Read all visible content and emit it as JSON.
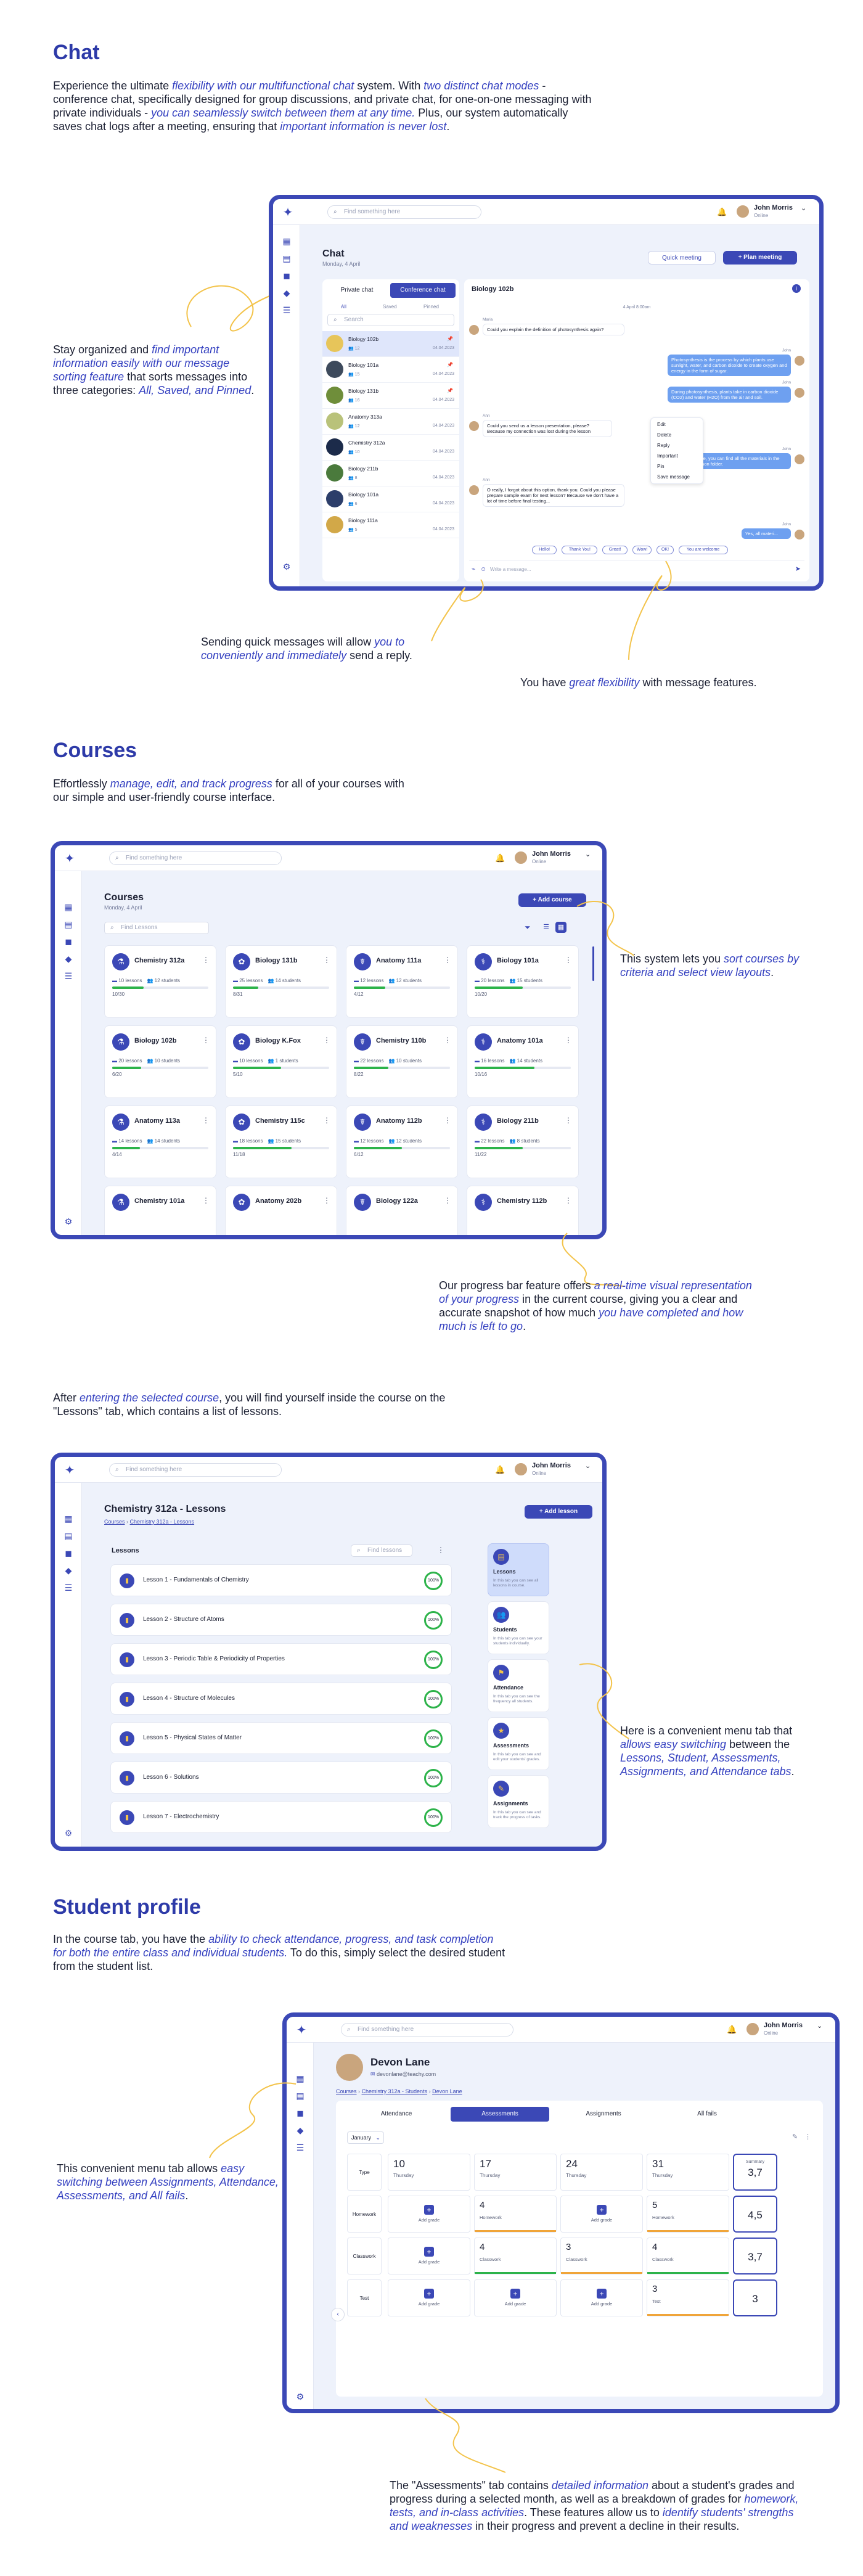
{
  "colors": {
    "accent": "#3b48b6",
    "emphasis": "#3440c0",
    "progress": "#2db34a",
    "warning": "#f0a53a"
  },
  "chat_section": {
    "title": "Chat",
    "intro": {
      "p1": "Experience the ultimate ",
      "e1": "flexibility with our multifunctional chat",
      "p2": " system. With ",
      "e2": "two distinct chat modes",
      "p3": " - conference chat, specifically designed for group discussions, and private chat, for one-on-one messaging with private individuals - ",
      "e3": "you can seamlessly switch between them at any time.",
      "p4": " Plus, our system automatically saves chat logs after a meeting, ensuring that ",
      "e4": "important information is never lost",
      "p5": "."
    },
    "note_left": {
      "p1": "Stay organized and ",
      "e1": "find important information easily with our message sorting feature",
      "p2": " that sorts messages into three categories: ",
      "e2": "All, Saved, and Pinned",
      "p3": "."
    },
    "note_bottom_left": {
      "p1": "Sending quick messages will allow ",
      "e1": "you to conveniently and immediately",
      "p2": " send a reply."
    },
    "note_bottom_right": {
      "p1": "You have ",
      "e1": "great flexibility",
      "p2": " with message features."
    },
    "app": {
      "search_placeholder": "Find something here",
      "user_name": "John Morris",
      "user_status": "Online",
      "page_title": "Chat",
      "page_date": "Monday, 4 April",
      "quick_meeting": "Quick meeting",
      "plan_meeting": "+ Plan meeting",
      "tabs": [
        "Private chat",
        "Conference chat"
      ],
      "filters": [
        "All",
        "Saved",
        "Pinned"
      ],
      "list_search": "Search",
      "chats": [
        {
          "name": "Biology 102b",
          "count": "12",
          "date": "04.04.2023",
          "pinned": true
        },
        {
          "name": "Biology 101a",
          "count": "15",
          "date": "04.04.2023",
          "pinned": true
        },
        {
          "name": "Biology 131b",
          "count": "16",
          "date": "04.04.2023",
          "pinned": true
        },
        {
          "name": "Anatomy 313a",
          "count": "12",
          "date": "04.04.2023",
          "pinned": false
        },
        {
          "name": "Chemistry 312a",
          "count": "10",
          "date": "04.04.2023",
          "pinned": false
        },
        {
          "name": "Biology 211b",
          "count": "8",
          "date": "04.04.2023",
          "pinned": false
        },
        {
          "name": "Biology 101a",
          "count": "6",
          "date": "04.04.2023",
          "pinned": false
        },
        {
          "name": "Biology 111a",
          "count": "5",
          "date": "04.04.2023",
          "pinned": false
        }
      ],
      "conversation_title": "Biology 102b",
      "conversation_date": "4 April 8:00am",
      "messages": [
        {
          "author": "Maria",
          "text": "Could you explain the definition of photosynthesis again?",
          "type": "in"
        },
        {
          "author": "John",
          "text": "Photosynthesis is the process by which plants use sunlight, water, and carbon dioxide to create oxygen and energy in the form of sugar.",
          "type": "out"
        },
        {
          "author": "John",
          "text": "During photosynthesis, plants take in carbon dioxide (CO2) and water (H2O) from the air and soil.",
          "type": "out"
        },
        {
          "author": "Ann",
          "text": "Could you send us a lesson presentation, please? Because my connection was lost during the lesson",
          "type": "in"
        },
        {
          "author": "John",
          "text": "Sure, you can find all the materials in the lesson folder.",
          "type": "out"
        },
        {
          "author": "Ann",
          "text": "O really, I forgot about this option, thank you. Could you please prepare sample exam for next lesson? Because we don't have a lot of time before final testing...",
          "type": "in"
        },
        {
          "author": "John",
          "text": "Yes, all materi...",
          "type": "out"
        }
      ],
      "context_menu": [
        "Edit",
        "Delete",
        "Reply",
        "Important",
        "Pin",
        "Save message"
      ],
      "quick_replies": [
        "Hello!",
        "Thank You!",
        "Great!",
        "Wow!",
        "OK!",
        "You are welcome"
      ],
      "message_placeholder": "Write a message..."
    }
  },
  "courses_section": {
    "title": "Courses",
    "intro": {
      "p1": "Effortlessly ",
      "e1": "manage, edit, and track progress",
      "p2": " for all of your courses with our simple and user-friendly course interface."
    },
    "note_right": {
      "p1": "This system lets you ",
      "e1": "sort courses by criteria and select view layouts",
      "p2": "."
    },
    "note_bottom": {
      "p1": "Our progress bar feature offers ",
      "e1": "a real-time visual representation of your progress",
      "p2": " in the current course, giving you a clear and accurate snapshot of how much ",
      "e2": "you have completed and how much is left to go",
      "p3": "."
    },
    "app": {
      "search_placeholder": "Find something here",
      "user_name": "John Morris",
      "user_status": "Online",
      "page_title": "Courses",
      "page_date": "Monday, 4 April",
      "add_course": "+ Add course",
      "lessons_search": "Find Lessons",
      "cards": [
        {
          "title": "Chemistry 312a",
          "lessons": "10 lessons",
          "students": "12 students",
          "progress": "10/30",
          "pct": 0.33
        },
        {
          "title": "Biology 131b",
          "lessons": "25 lessons",
          "students": "14 students",
          "progress": "8/31",
          "pct": 0.26
        },
        {
          "title": "Anatomy 111a",
          "lessons": "12 lessons",
          "students": "12 students",
          "progress": "4/12",
          "pct": 0.33
        },
        {
          "title": "Biology 101a",
          "lessons": "20 lessons",
          "students": "15 students",
          "progress": "10/20",
          "pct": 0.5
        },
        {
          "title": "Biology 102b",
          "lessons": "20 lessons",
          "students": "10 students",
          "progress": "6/20",
          "pct": 0.3
        },
        {
          "title": "Biology K.Fox",
          "lessons": "10 lessons",
          "students": "1 students",
          "progress": "5/10",
          "pct": 0.5
        },
        {
          "title": "Chemistry 110b",
          "lessons": "22 lessons",
          "students": "10 students",
          "progress": "8/22",
          "pct": 0.36
        },
        {
          "title": "Anatomy 101a",
          "lessons": "16 lessons",
          "students": "14 students",
          "progress": "10/16",
          "pct": 0.62
        },
        {
          "title": "Anatomy 113a",
          "lessons": "14 lessons",
          "students": "14 students",
          "progress": "4/14",
          "pct": 0.29
        },
        {
          "title": "Chemistry 115c",
          "lessons": "18 lessons",
          "students": "15 students",
          "progress": "11/18",
          "pct": 0.61
        },
        {
          "title": "Anatomy 112b",
          "lessons": "12 lessons",
          "students": "12 students",
          "progress": "6/12",
          "pct": 0.5
        },
        {
          "title": "Biology 211b",
          "lessons": "22 lessons",
          "students": "8 students",
          "progress": "11/22",
          "pct": 0.5
        },
        {
          "title": "Chemistry 101a",
          "lessons": "",
          "students": "",
          "progress": "",
          "pct": 0
        },
        {
          "title": "Anatomy 202b",
          "lessons": "",
          "students": "",
          "progress": "",
          "pct": 0
        },
        {
          "title": "Biology 122a",
          "lessons": "",
          "students": "",
          "progress": "",
          "pct": 0
        },
        {
          "title": "Chemistry 112b",
          "lessons": "",
          "students": "",
          "progress": "",
          "pct": 0
        }
      ]
    }
  },
  "lessons_section": {
    "intro": {
      "p1": "After ",
      "e1": "entering the selected course",
      "p2": ", you will find yourself inside the course on the \"Lessons\" tab, which contains a list of lessons."
    },
    "note_right": {
      "p1": "Here is a convenient menu tab that ",
      "e1": "allows easy switching",
      "p2": " between the ",
      "e2": "Lessons, Student, Assessments, Assignments, and Attendance tabs",
      "p3": "."
    },
    "app": {
      "search_placeholder": "Find something here",
      "user_name": "John Morris",
      "user_status": "Online",
      "page_title": "Chemistry 312a - Lessons",
      "breadcrumb": [
        "Courses",
        "Chemistry 312a - Lessons"
      ],
      "add_lesson": "+ Add lesson",
      "list_title": "Lessons",
      "list_search": "Find lessons",
      "lessons": [
        {
          "title": "Lesson 1 - Fundamentals of Chemistry",
          "pct": "100%"
        },
        {
          "title": "Lesson 2 - Structure of Atoms",
          "pct": "100%"
        },
        {
          "title": "Lesson 3 - Periodic Table & Periodicity of Properties",
          "pct": "100%"
        },
        {
          "title": "Lesson 4 - Structure of Molecules",
          "pct": "100%"
        },
        {
          "title": "Lesson 5 - Physical States of Matter",
          "pct": "100%"
        },
        {
          "title": "Lesson 6 - Solutions",
          "pct": "100%"
        },
        {
          "title": "Lesson 7 - Electrochemistry",
          "pct": "100%"
        }
      ],
      "menu": [
        {
          "title": "Lessons",
          "desc": "In this tab you can see all lessons in course."
        },
        {
          "title": "Students",
          "desc": "In this tab you can see your students individually."
        },
        {
          "title": "Attendance",
          "desc": "In this tab you can see the frequency all students."
        },
        {
          "title": "Assessments",
          "desc": "In this tab you can see and edit your students' grades."
        },
        {
          "title": "Assignments",
          "desc": "In this tab you can see and track the progress of tasks."
        }
      ]
    }
  },
  "profile_section": {
    "title": "Student profile",
    "intro": {
      "p1": "In the course tab, you have the ",
      "e1": "ability to check attendance, progress, and task completion for both the entire class and individual students.",
      "p2": " To do this, simply select the desired student from the student list."
    },
    "note_left": {
      "p1": "This convenient menu tab allows ",
      "e1": "easy switching between Assignments, Attendance, Assessments, and All fails",
      "p2": "."
    },
    "note_bottom": {
      "p1": "The \"Assessments\" tab contains ",
      "e1": "detailed information",
      "p2": " about a student's grades and progress during a selected month, as well as a breakdown of grades for ",
      "e2": "homework, tests, and in-class activities",
      "p3": ". These features allow us to ",
      "e3": "identify students' strengths and weaknesses",
      "p4": " in their progress and prevent a decline in their results."
    },
    "app": {
      "search_placeholder": "Find something here",
      "user_name": "John Morris",
      "user_status": "Online",
      "student_name": "Devon Lane",
      "student_email": "devonlane@teachy.com",
      "breadcrumb": [
        "Courses",
        "Chemistry 312a - Students",
        "Devon Lane"
      ],
      "tabs": [
        "Attendance",
        "Assessments",
        "Assignments",
        "All fails"
      ],
      "month": "January",
      "columns": [
        {
          "num": "10",
          "day": "Thursday"
        },
        {
          "num": "17",
          "day": "Thursday"
        },
        {
          "num": "24",
          "day": "Thursday"
        },
        {
          "num": "31",
          "day": "Thursday"
        }
      ],
      "type_label": "Type",
      "summary_label": "Summary",
      "rows": [
        {
          "label": "Homework",
          "cells": [
            {
              "add": true,
              "v": "",
              "l": "Add grade"
            },
            {
              "add": false,
              "v": "4",
              "l": "Homework"
            },
            {
              "add": true,
              "v": "",
              "l": "Add grade"
            },
            {
              "add": false,
              "v": "5",
              "l": "Homework"
            }
          ],
          "summary": "4,5"
        },
        {
          "label": "Classwork",
          "cells": [
            {
              "add": true,
              "v": "",
              "l": "Add grade"
            },
            {
              "add": false,
              "v": "4",
              "l": "Classwork"
            },
            {
              "add": false,
              "v": "3",
              "l": "Classwork"
            },
            {
              "add": false,
              "v": "4",
              "l": "Classwork"
            }
          ],
          "summary": "3,7"
        },
        {
          "label": "Test",
          "cells": [
            {
              "add": true,
              "v": "",
              "l": "Add grade"
            },
            {
              "add": true,
              "v": "",
              "l": "Add grade"
            },
            {
              "add": true,
              "v": "",
              "l": "Add grade"
            },
            {
              "add": false,
              "v": "3",
              "l": "Test"
            }
          ],
          "summary": "3"
        }
      ],
      "summary_top": "3,7"
    }
  }
}
